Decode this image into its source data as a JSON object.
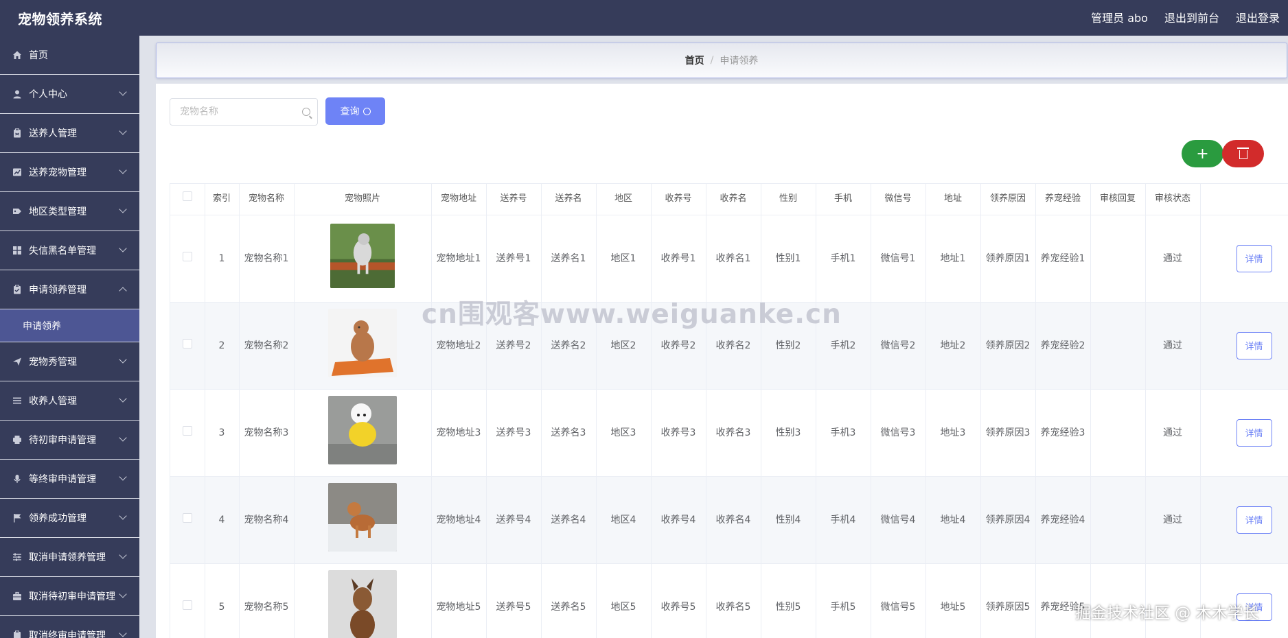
{
  "app": {
    "title": "宠物领养系统",
    "admin_label": "管理员 abo",
    "to_front": "退出到前台",
    "logout": "退出登录"
  },
  "sidebar": {
    "items": [
      {
        "label": "首页",
        "icon": "home-icon",
        "expand": "none"
      },
      {
        "label": "个人中心",
        "icon": "user-icon",
        "expand": "down"
      },
      {
        "label": "送养人管理",
        "icon": "clipboard-icon",
        "expand": "down"
      },
      {
        "label": "送养宠物管理",
        "icon": "chart-icon",
        "expand": "down"
      },
      {
        "label": "地区类型管理",
        "icon": "tag-icon",
        "expand": "down"
      },
      {
        "label": "失信黑名单管理",
        "icon": "grid-icon",
        "expand": "down"
      },
      {
        "label": "申请领养管理",
        "icon": "clipboard-check-icon",
        "expand": "up"
      }
    ],
    "submenu": {
      "label": "申请领养"
    },
    "items2": [
      {
        "label": "宠物秀管理",
        "icon": "send-icon"
      },
      {
        "label": "收养人管理",
        "icon": "list-icon"
      },
      {
        "label": "待初审申请管理",
        "icon": "printer-icon"
      },
      {
        "label": "等终审申请管理",
        "icon": "mic-icon"
      },
      {
        "label": "领养成功管理",
        "icon": "flag-icon"
      },
      {
        "label": "取消申请领养管理",
        "icon": "sliders-icon"
      },
      {
        "label": "取消待初审申请管理",
        "icon": "briefcase-icon"
      },
      {
        "label": "取消终审申请管理",
        "icon": "clipboard-icon"
      }
    ]
  },
  "breadcrumb": {
    "home": "首页",
    "separator": "/",
    "current": "申请领养"
  },
  "search": {
    "placeholder": "宠物名称",
    "button_label": "查询"
  },
  "actions": {
    "add": "+"
  },
  "table": {
    "headers": [
      "索引",
      "宠物名称",
      "宠物照片",
      "宠物地址",
      "送养号",
      "送养名",
      "地区",
      "收养号",
      "收养名",
      "性别",
      "手机",
      "微信号",
      "地址",
      "领养原因",
      "养宠经验",
      "审核回复",
      "审核状态"
    ],
    "detail_label": "详情",
    "rows": [
      {
        "index": "1",
        "name": "宠物名称1",
        "photo": "dog-running-photo",
        "address": "宠物地址1",
        "song_no": "送养号1",
        "song_name": "送养名1",
        "region": "地区1",
        "shou_no": "收养号1",
        "shou_name": "收养名1",
        "gender": "性别1",
        "phone": "手机1",
        "wechat": "微信号1",
        "addr": "地址1",
        "reason": "领养原因1",
        "exp": "养宠经验1",
        "reply": "",
        "status": "通过"
      },
      {
        "index": "2",
        "name": "宠物名称2",
        "photo": "poodle-on-cushion-photo",
        "address": "宠物地址2",
        "song_no": "送养号2",
        "song_name": "送养名2",
        "region": "地区2",
        "shou_no": "收养号2",
        "shou_name": "收养名2",
        "gender": "性别2",
        "phone": "手机2",
        "wechat": "微信号2",
        "addr": "地址2",
        "reason": "领养原因2",
        "exp": "养宠经验2",
        "reply": "",
        "status": "通过"
      },
      {
        "index": "3",
        "name": "宠物名称3",
        "photo": "white-poodle-yellow-coat-photo",
        "address": "宠物地址3",
        "song_no": "送养号3",
        "song_name": "送养名3",
        "region": "地区3",
        "shou_no": "收养号3",
        "shou_name": "收养名3",
        "gender": "性别3",
        "phone": "手机3",
        "wechat": "微信号3",
        "addr": "地址3",
        "reason": "领养原因3",
        "exp": "养宠经验3",
        "reply": "",
        "status": "通过"
      },
      {
        "index": "4",
        "name": "宠物名称4",
        "photo": "shiba-in-snow-photo",
        "address": "宠物地址4",
        "song_no": "送养号4",
        "song_name": "送养名4",
        "region": "地区4",
        "shou_no": "收养号4",
        "shou_name": "收养名4",
        "gender": "性别4",
        "phone": "手机4",
        "wechat": "微信号4",
        "addr": "地址4",
        "reason": "领养原因4",
        "exp": "养宠经验4",
        "reply": "",
        "status": "通过"
      },
      {
        "index": "5",
        "name": "宠物名称5",
        "photo": "shepherd-dog-photo",
        "address": "宠物地址5",
        "song_no": "送养号5",
        "song_name": "送养名5",
        "region": "地区5",
        "shou_no": "收养号5",
        "shou_name": "收养名5",
        "gender": "性别5",
        "phone": "手机5",
        "wechat": "微信号5",
        "addr": "地址5",
        "reason": "领养原因5",
        "exp": "养宠经验5",
        "reply": "",
        "status": ""
      }
    ]
  },
  "watermark": {
    "center": "cn围观客www.weiguanke.cn",
    "corner": "掘金技术社区 @ 木木学长"
  },
  "colors": {
    "header": "#363c5a",
    "active_submenu": "#4d5694",
    "primary": "#6e83f6",
    "add": "#2a9b3f",
    "delete": "#d22b2b"
  }
}
